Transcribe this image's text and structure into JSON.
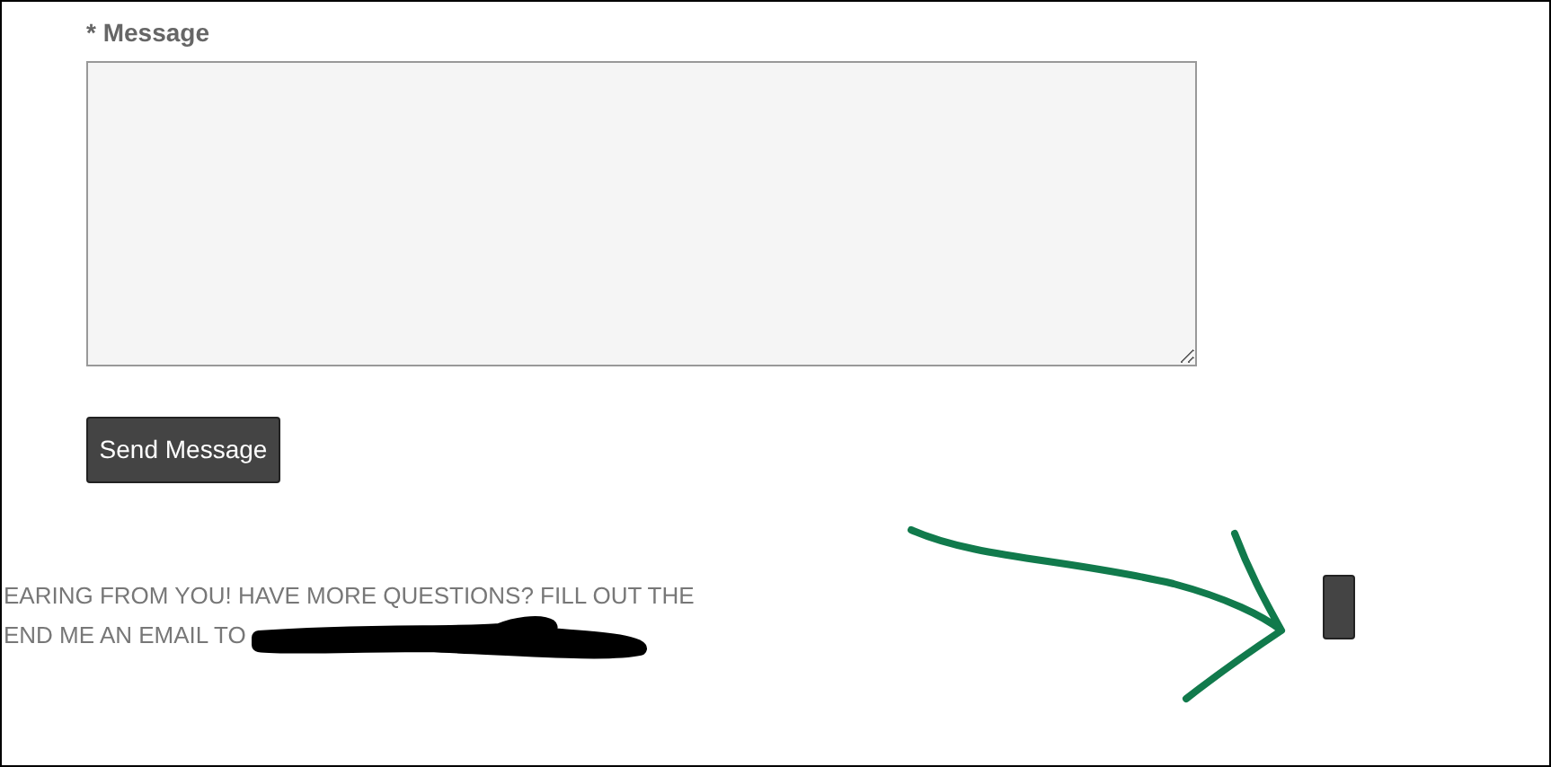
{
  "form": {
    "message_label": "* Message",
    "submit_button": "Send Message"
  },
  "footer_text": [
    "EARING FROM YOU! HAVE MORE QUESTIONS? FILL OUT THE",
    "END ME AN EMAIL TO"
  ]
}
